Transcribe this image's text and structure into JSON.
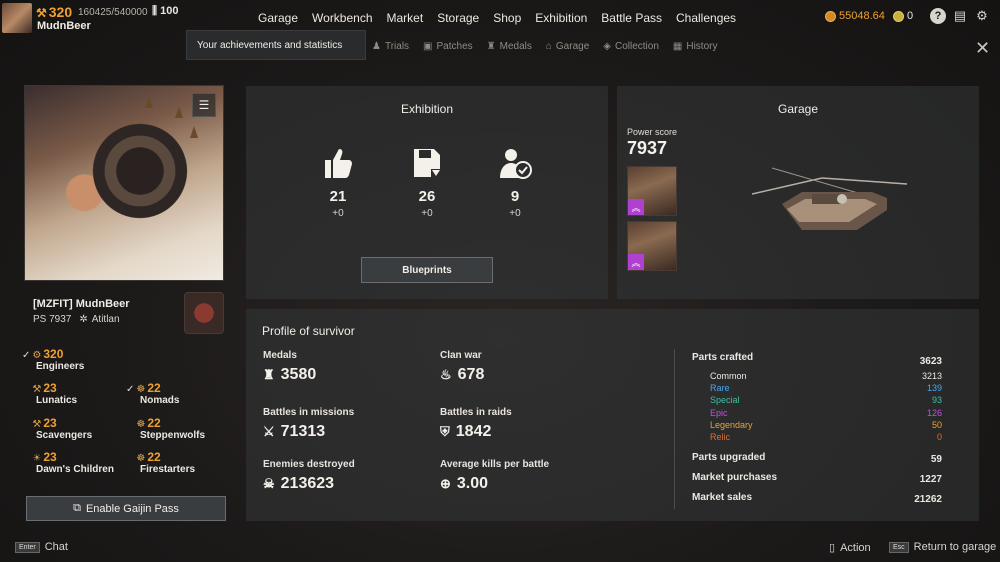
{
  "player": {
    "level": "320",
    "xp": "160425/540000",
    "rank_value": "100",
    "name": "MudnBeer"
  },
  "nav": [
    "Garage",
    "Workbench",
    "Market",
    "Storage",
    "Shop",
    "Exhibition",
    "Battle Pass",
    "Challenges"
  ],
  "currency": {
    "coins": "55048.64",
    "other": "0"
  },
  "tooltip": "Your achievements and statistics",
  "subnav": [
    "Trials",
    "Patches",
    "Medals",
    "Garage",
    "Collection",
    "History"
  ],
  "profile_card": {
    "clan_name": "[MZFIT] MudnBeer",
    "ps": "PS 7937",
    "region": "Atitlan"
  },
  "factions": [
    {
      "level": "320",
      "name": "Engineers",
      "checked": true
    },
    {
      "level": "23",
      "name": "Lunatics",
      "checked": false
    },
    {
      "level": "22",
      "name": "Nomads",
      "checked": true
    },
    {
      "level": "23",
      "name": "Scavengers",
      "checked": false
    },
    {
      "level": "22",
      "name": "Steppenwolfs",
      "checked": false
    },
    {
      "level": "23",
      "name": "Dawn's Children",
      "checked": false
    },
    {
      "level": "22",
      "name": "Firestarters",
      "checked": false
    }
  ],
  "gaijin_button": "Enable Gaijin Pass",
  "exhibition": {
    "title": "Exhibition",
    "stats": [
      {
        "icon": "thumbs-up-icon",
        "value": "21",
        "delta": "+0"
      },
      {
        "icon": "save-icon",
        "value": "26",
        "delta": "+0"
      },
      {
        "icon": "user-check-icon",
        "value": "9",
        "delta": "+0"
      }
    ],
    "button": "Blueprints"
  },
  "garage": {
    "title": "Garage",
    "power_label": "Power score",
    "power_value": "7937"
  },
  "survivor": {
    "title": "Profile of survivor",
    "stats": [
      {
        "label": "Medals",
        "value": "3580",
        "icon": "medal-icon"
      },
      {
        "label": "Clan war",
        "value": "678",
        "icon": "flame-icon"
      },
      {
        "label": "Battles in missions",
        "value": "71313",
        "icon": "missions-icon"
      },
      {
        "label": "Battles in raids",
        "value": "1842",
        "icon": "raids-icon"
      },
      {
        "label": "Enemies destroyed",
        "value": "213623",
        "icon": "skull-icon"
      },
      {
        "label": "Average kills per battle",
        "value": "3.00",
        "icon": "kills-icon"
      }
    ],
    "parts_crafted": {
      "label": "Parts crafted",
      "value": "3623"
    },
    "rarities": [
      {
        "label": "Common",
        "value": "3213",
        "color": "#e8e4de"
      },
      {
        "label": "Rare",
        "value": "139",
        "color": "#4aa6f0"
      },
      {
        "label": "Special",
        "value": "93",
        "color": "#3fc0a0"
      },
      {
        "label": "Epic",
        "value": "126",
        "color": "#c050e0"
      },
      {
        "label": "Legendary",
        "value": "50",
        "color": "#f0a030"
      },
      {
        "label": "Relic",
        "value": "0",
        "color": "#e06a30"
      }
    ],
    "parts_upgraded": {
      "label": "Parts upgraded",
      "value": "59"
    },
    "market_purchases": {
      "label": "Market purchases",
      "value": "1227"
    },
    "market_sales": {
      "label": "Market sales",
      "value": "21262"
    }
  },
  "footer": {
    "chat_key": "Enter",
    "chat": "Chat",
    "action": "Action",
    "return_key": "Esc",
    "return": "Return to garage"
  }
}
